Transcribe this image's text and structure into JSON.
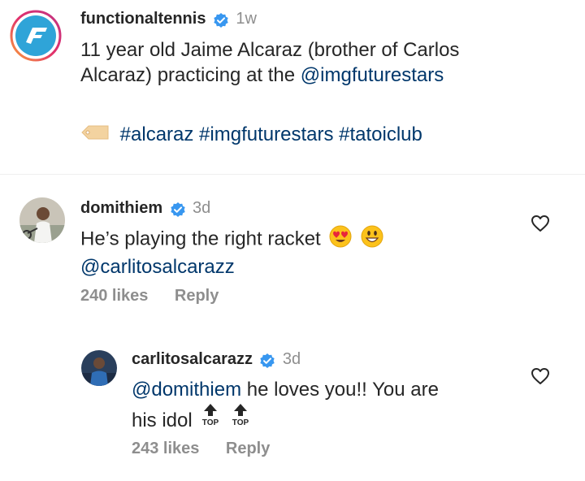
{
  "post": {
    "username": "functionaltennis",
    "time": "1w",
    "caption_line1": "11 year old Jaime Alcaraz (brother of Carlos",
    "caption_line2_text": "Alcaraz) practicing at the ",
    "caption_mention": "@imgfuturestars",
    "hashtags": "#alcaraz #imgfuturestars #tatoiclub",
    "avatar_icon": "functionaltennis-logo",
    "tag_icon": "label-tag-emoji"
  },
  "comments": [
    {
      "username": "domithiem",
      "time": "3d",
      "text_line1": "He’s playing the right racket",
      "text_line2": "@carlitosalcarazz",
      "emojis": [
        "heart-eyes-emoji",
        "grinning-face-emoji"
      ],
      "likes": "240 likes",
      "reply": "Reply"
    },
    {
      "username": "carlitosalcarazz",
      "time": "3d",
      "mention": "@domithiem",
      "text_line1_rest": " he loves you!! You are",
      "text_line2": "his idol",
      "emojis": [
        "top-arrow-emoji",
        "top-arrow-emoji"
      ],
      "top_label": "TOP",
      "likes": "243 likes",
      "reply": "Reply"
    }
  ],
  "colors": {
    "link": "#00376b",
    "verified": "#3897f0",
    "muted": "#8e8e8e",
    "text": "#262626"
  }
}
